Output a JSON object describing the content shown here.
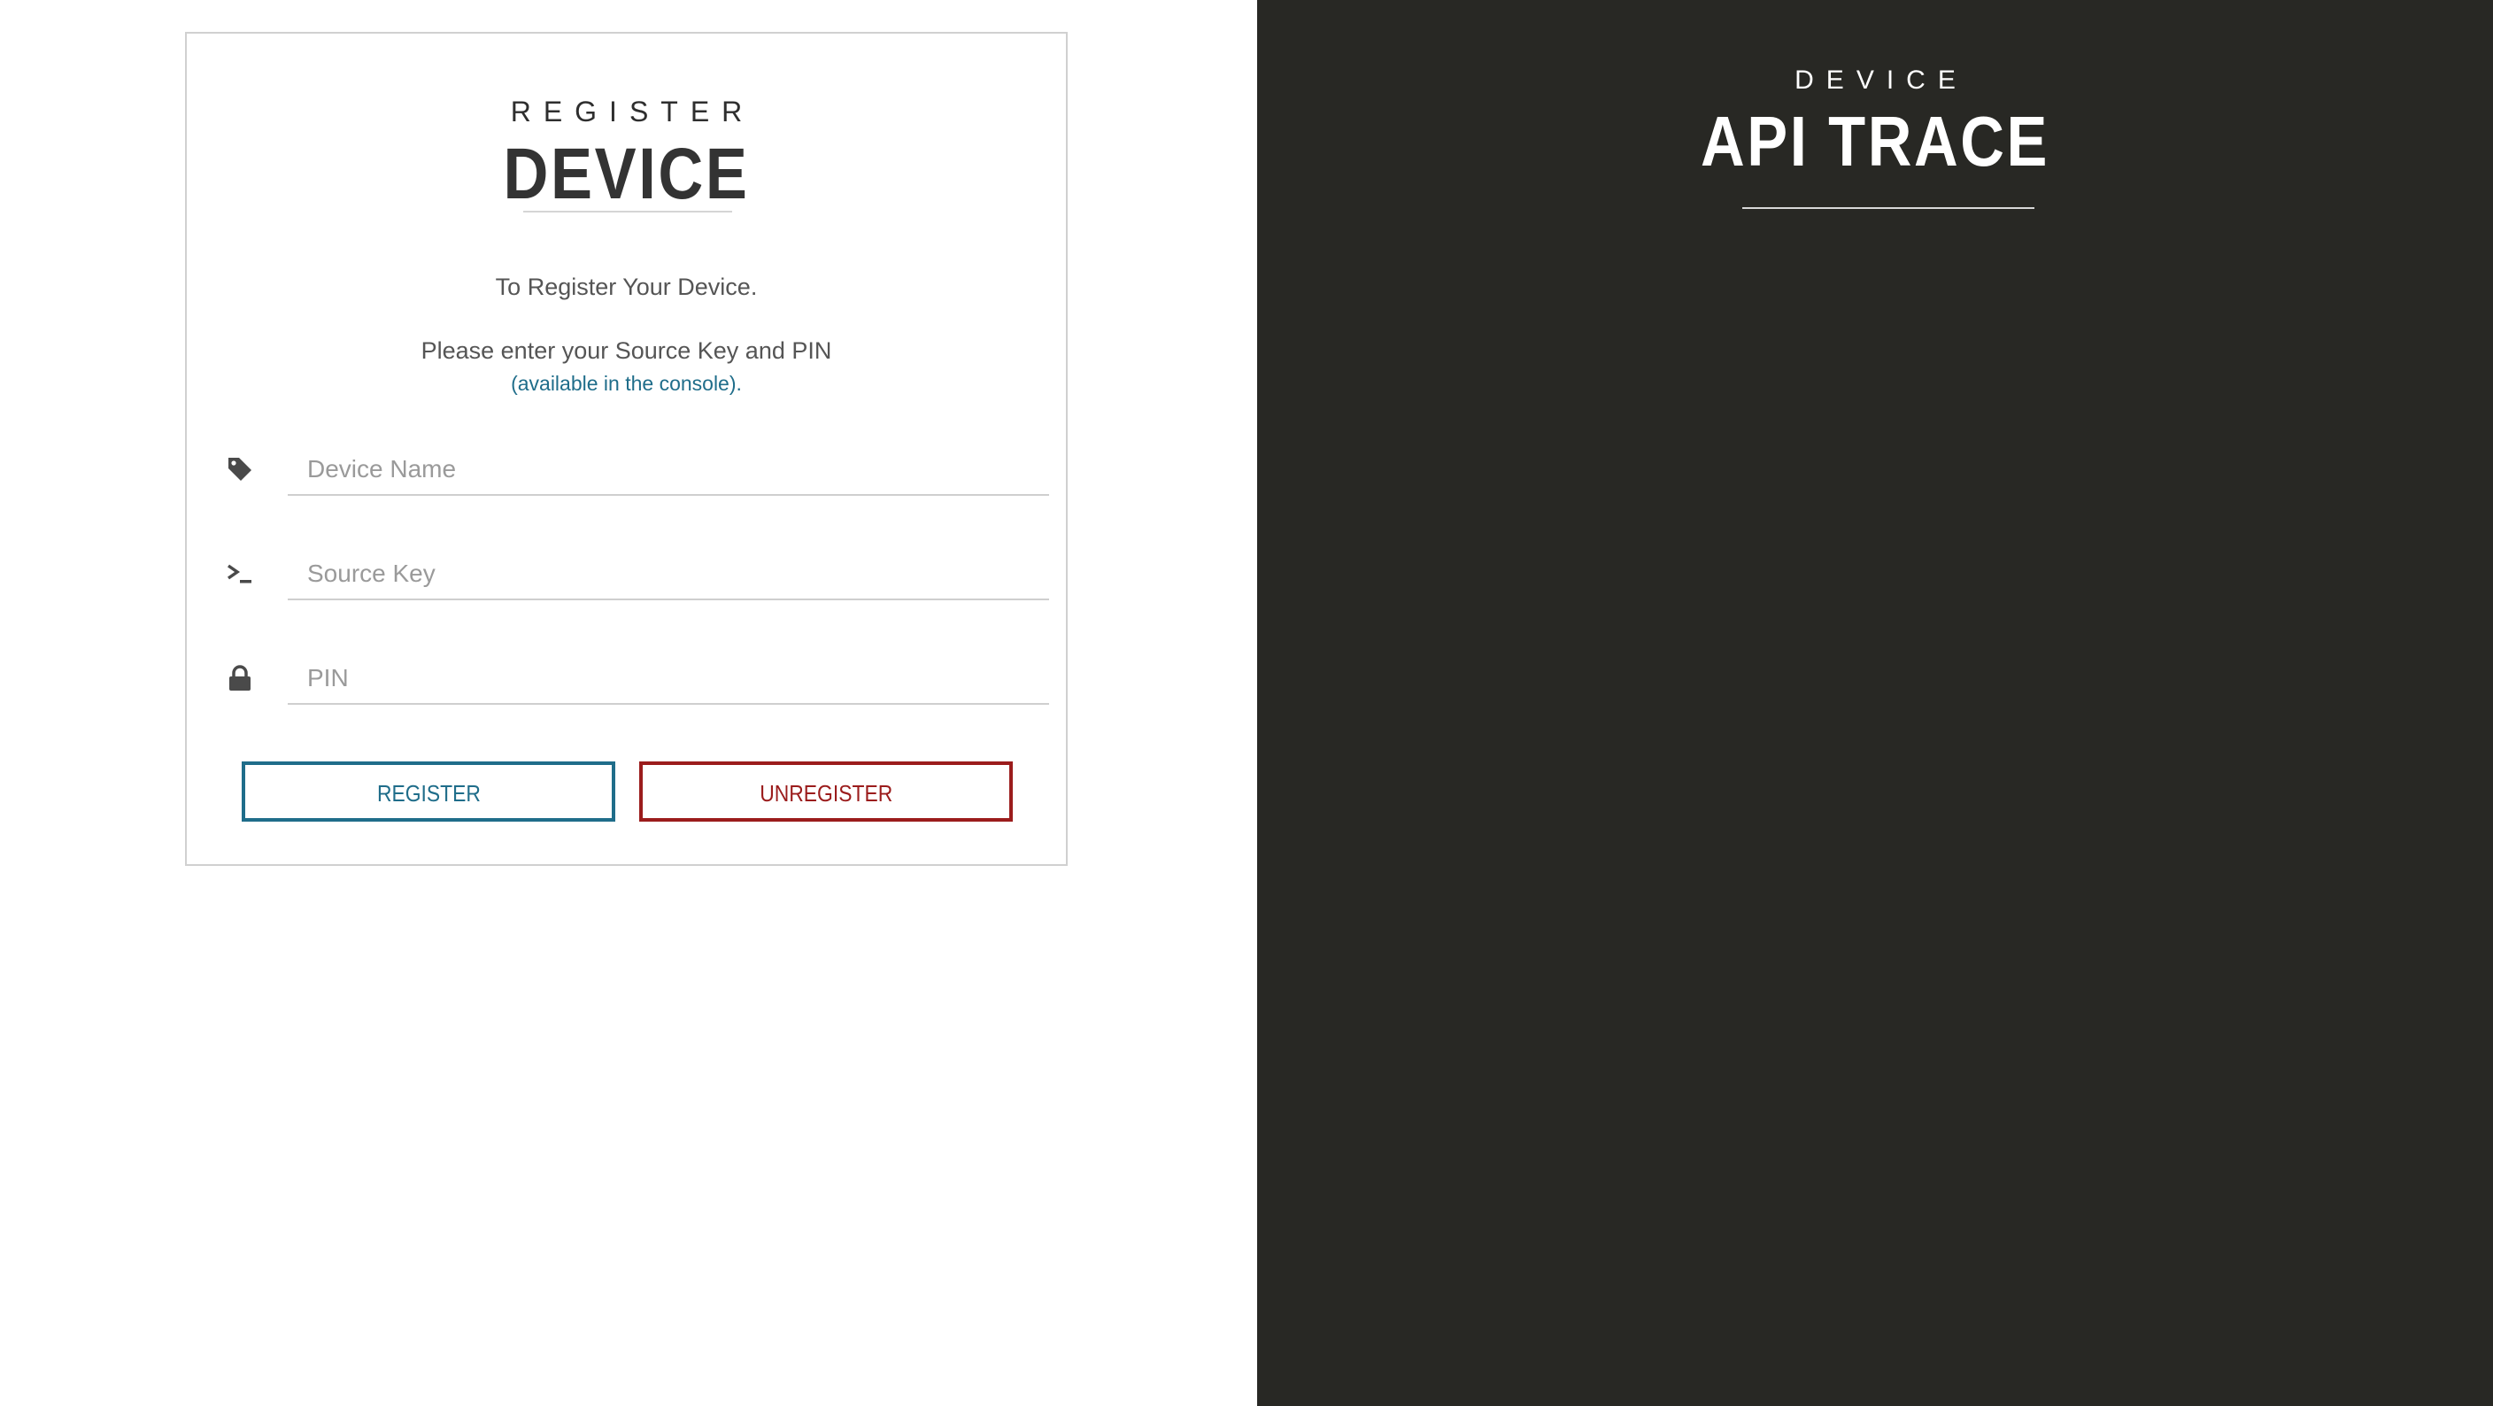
{
  "register_panel": {
    "kicker": "REGISTER",
    "title": "DEVICE",
    "intro": "To Register Your Device.",
    "instructions": "Please enter your Source Key and PIN",
    "hint": "(available in the console)."
  },
  "form": {
    "fields": [
      {
        "icon": "tag-icon",
        "placeholder": "Device Name",
        "value": ""
      },
      {
        "icon": "terminal-icon",
        "placeholder": "Source Key",
        "value": ""
      },
      {
        "icon": "lock-icon",
        "placeholder": "PIN",
        "value": ""
      }
    ],
    "register_label": "REGISTER",
    "unregister_label": "UNREGISTER"
  },
  "trace_panel": {
    "kicker": "DEVICE",
    "title": "API TRACE"
  },
  "colors": {
    "primary": "#1f6d8a",
    "danger": "#9b1c1c",
    "dark_panel": "#282824",
    "text": "#333333"
  }
}
